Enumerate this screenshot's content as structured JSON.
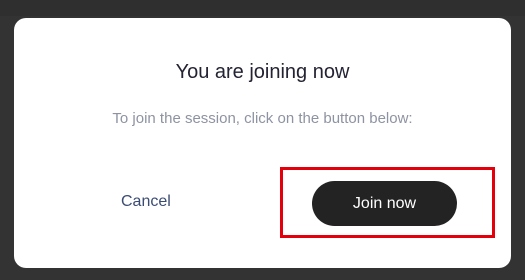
{
  "dialog": {
    "title": "You are joining now",
    "subtitle": "To join the session, click on the button below:",
    "cancel_label": "Cancel",
    "join_label": "Join now"
  },
  "colors": {
    "highlight": "#e3000b",
    "join_button": "#232323",
    "cancel_text": "#3b4c74"
  }
}
